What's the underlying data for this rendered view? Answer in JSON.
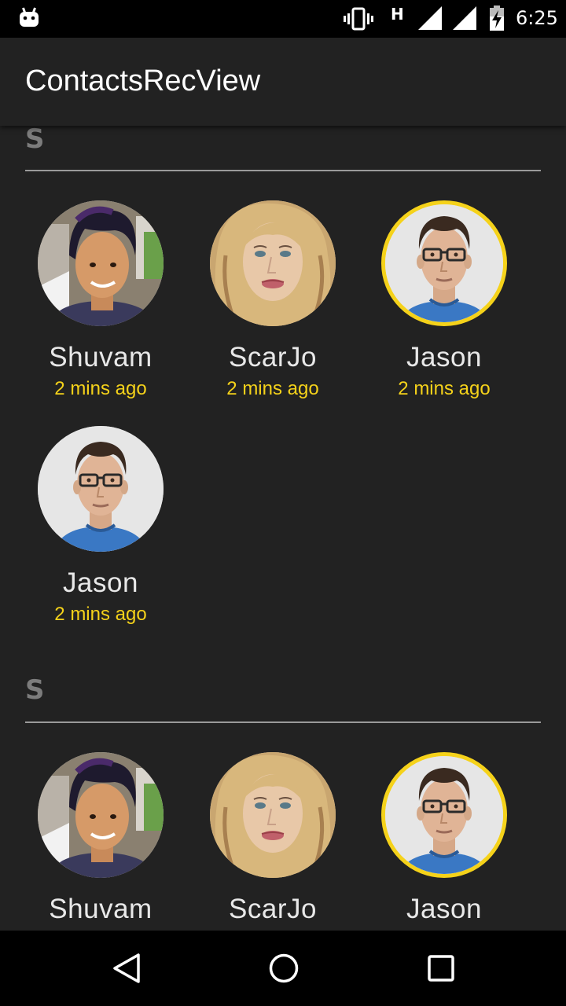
{
  "status_bar": {
    "time": "6:25",
    "network": "H",
    "icons": [
      "android-icon",
      "vibrate-icon",
      "signal-icon",
      "signal-icon",
      "battery-charging-icon"
    ]
  },
  "app_bar": {
    "title": "ContactsRecView"
  },
  "sections": [
    {
      "letter": "S",
      "contacts": [
        {
          "name": "Shuvam",
          "time": "2 mins ago",
          "avatar": "shuvam",
          "highlighted": false
        },
        {
          "name": "ScarJo",
          "time": "2 mins ago",
          "avatar": "scarjo",
          "highlighted": false
        },
        {
          "name": "Jason",
          "time": "2 mins ago",
          "avatar": "jason",
          "highlighted": true
        },
        {
          "name": "Jason",
          "time": "2 mins ago",
          "avatar": "jason",
          "highlighted": false
        }
      ]
    },
    {
      "letter": "S",
      "contacts": [
        {
          "name": "Shuvam",
          "time": "",
          "avatar": "shuvam",
          "highlighted": false
        },
        {
          "name": "ScarJo",
          "time": "",
          "avatar": "scarjo",
          "highlighted": false
        },
        {
          "name": "Jason",
          "time": "",
          "avatar": "jason",
          "highlighted": true
        }
      ]
    }
  ],
  "nav_bar": {
    "buttons": [
      "back-icon",
      "home-icon",
      "recents-icon"
    ]
  },
  "colors": {
    "accent": "#f5d21a",
    "background": "#222222",
    "header_text": "#7c7c7c"
  }
}
